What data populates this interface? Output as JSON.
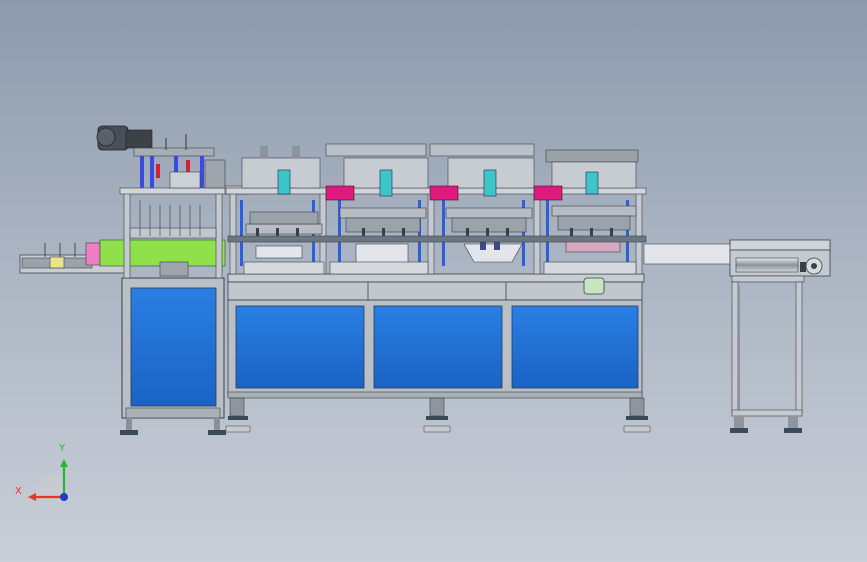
{
  "triad": {
    "x_label": "X",
    "y_label": "Y",
    "x_color": "#e8322e",
    "y_color": "#23b832",
    "z_color": "#2a35c8"
  },
  "colors": {
    "background_top": "#8e9aac",
    "background_bottom": "#c9cfd8",
    "panel_blue": "#1d6fd6",
    "frame_gray": "#b9bfc6",
    "magenta": "#e0197d",
    "green_plate": "#8fe04a",
    "teal": "#3cc6c8"
  }
}
